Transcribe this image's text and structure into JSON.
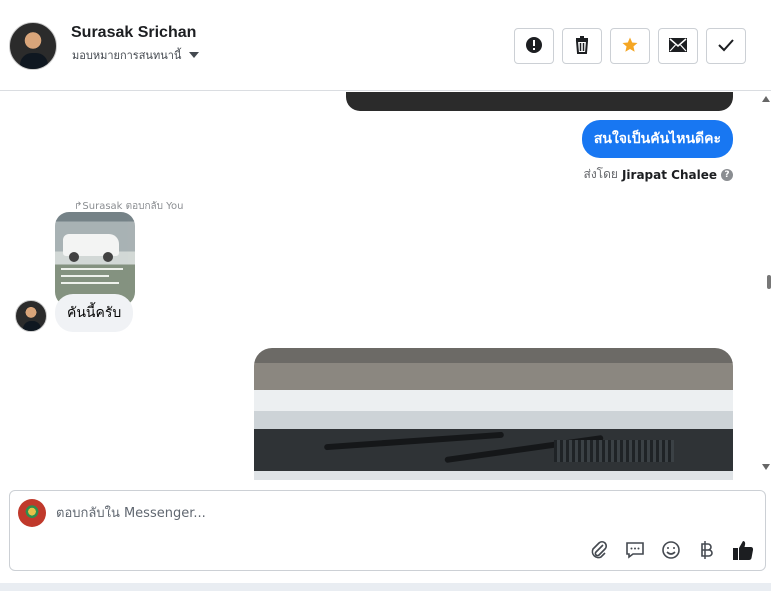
{
  "header": {
    "name": "Surasak Srichan",
    "assign_label": "มอบหมายการสนทนานี้",
    "buttons": [
      {
        "name": "mark-spam",
        "icon": "alert-circle-icon"
      },
      {
        "name": "delete",
        "icon": "trash-icon"
      },
      {
        "name": "star",
        "icon": "star-icon",
        "color": "#f5a623"
      },
      {
        "name": "mark-unread",
        "icon": "envelope-icon"
      },
      {
        "name": "mark-done",
        "icon": "checkmark-icon"
      }
    ]
  },
  "conversation": {
    "sent_message": "สนใจเป็นคันไหนดีคะ",
    "sent_by_prefix": "ส่งโดย",
    "sent_by_name": "Jirapat Chalee",
    "reply_label": "Surasak ตอบกลับ You",
    "received_message": "คันนี้ครับ"
  },
  "composer": {
    "placeholder": "ตอบกลับใน Messenger...",
    "tools": [
      "paperclip-icon",
      "speech-bubble-icon",
      "smiley-icon",
      "baht-icon",
      "thumbs-up-icon"
    ]
  },
  "colors": {
    "accent": "#1877f2",
    "star": "#f5a623"
  }
}
